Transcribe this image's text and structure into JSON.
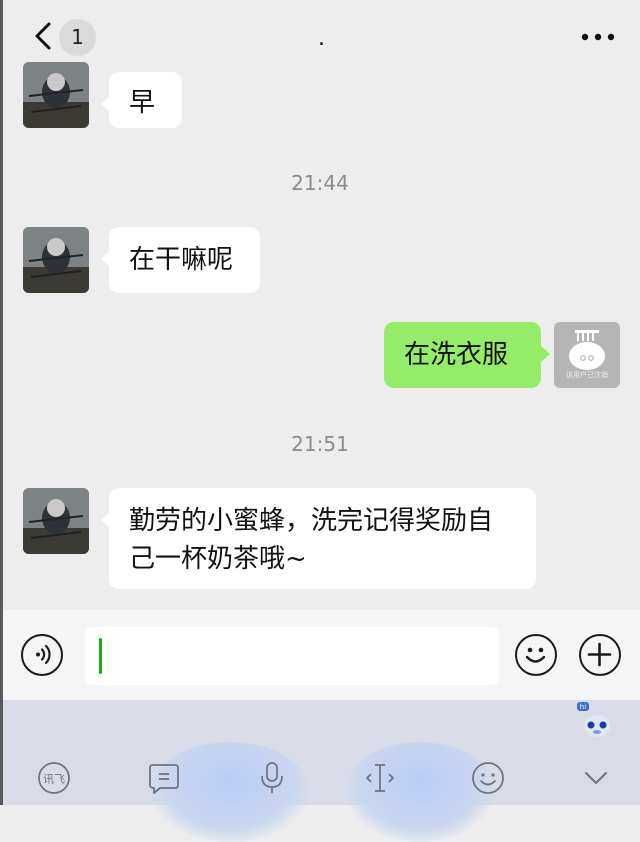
{
  "header": {
    "back_badge": "1",
    "title": "."
  },
  "messages": [
    {
      "side": "left",
      "text": "早"
    },
    {
      "type": "time",
      "text": "21:44"
    },
    {
      "side": "left",
      "text": "在干嘛呢"
    },
    {
      "side": "right",
      "text": "在洗衣服"
    },
    {
      "type": "time",
      "text": "21:51"
    },
    {
      "side": "left",
      "lines": [
        "勤劳的小蜜蜂，洗完记得奖励自",
        "己一杯奶茶哦~"
      ]
    }
  ],
  "my_avatar": {
    "caption": "该用户已注销"
  },
  "keyboard": {
    "hi_label": "hi"
  },
  "colors": {
    "self_bubble": "#95ec69",
    "other_bubble": "#ffffff",
    "caret": "#1aad19",
    "background": "#ededed"
  },
  "icons": [
    "back-icon",
    "more-icon",
    "voice-icon",
    "emoji-icon",
    "plus-icon",
    "translate-icon",
    "message-icon",
    "mic-icon",
    "text-cursor-icon",
    "smile-icon",
    "collapse-icon"
  ]
}
